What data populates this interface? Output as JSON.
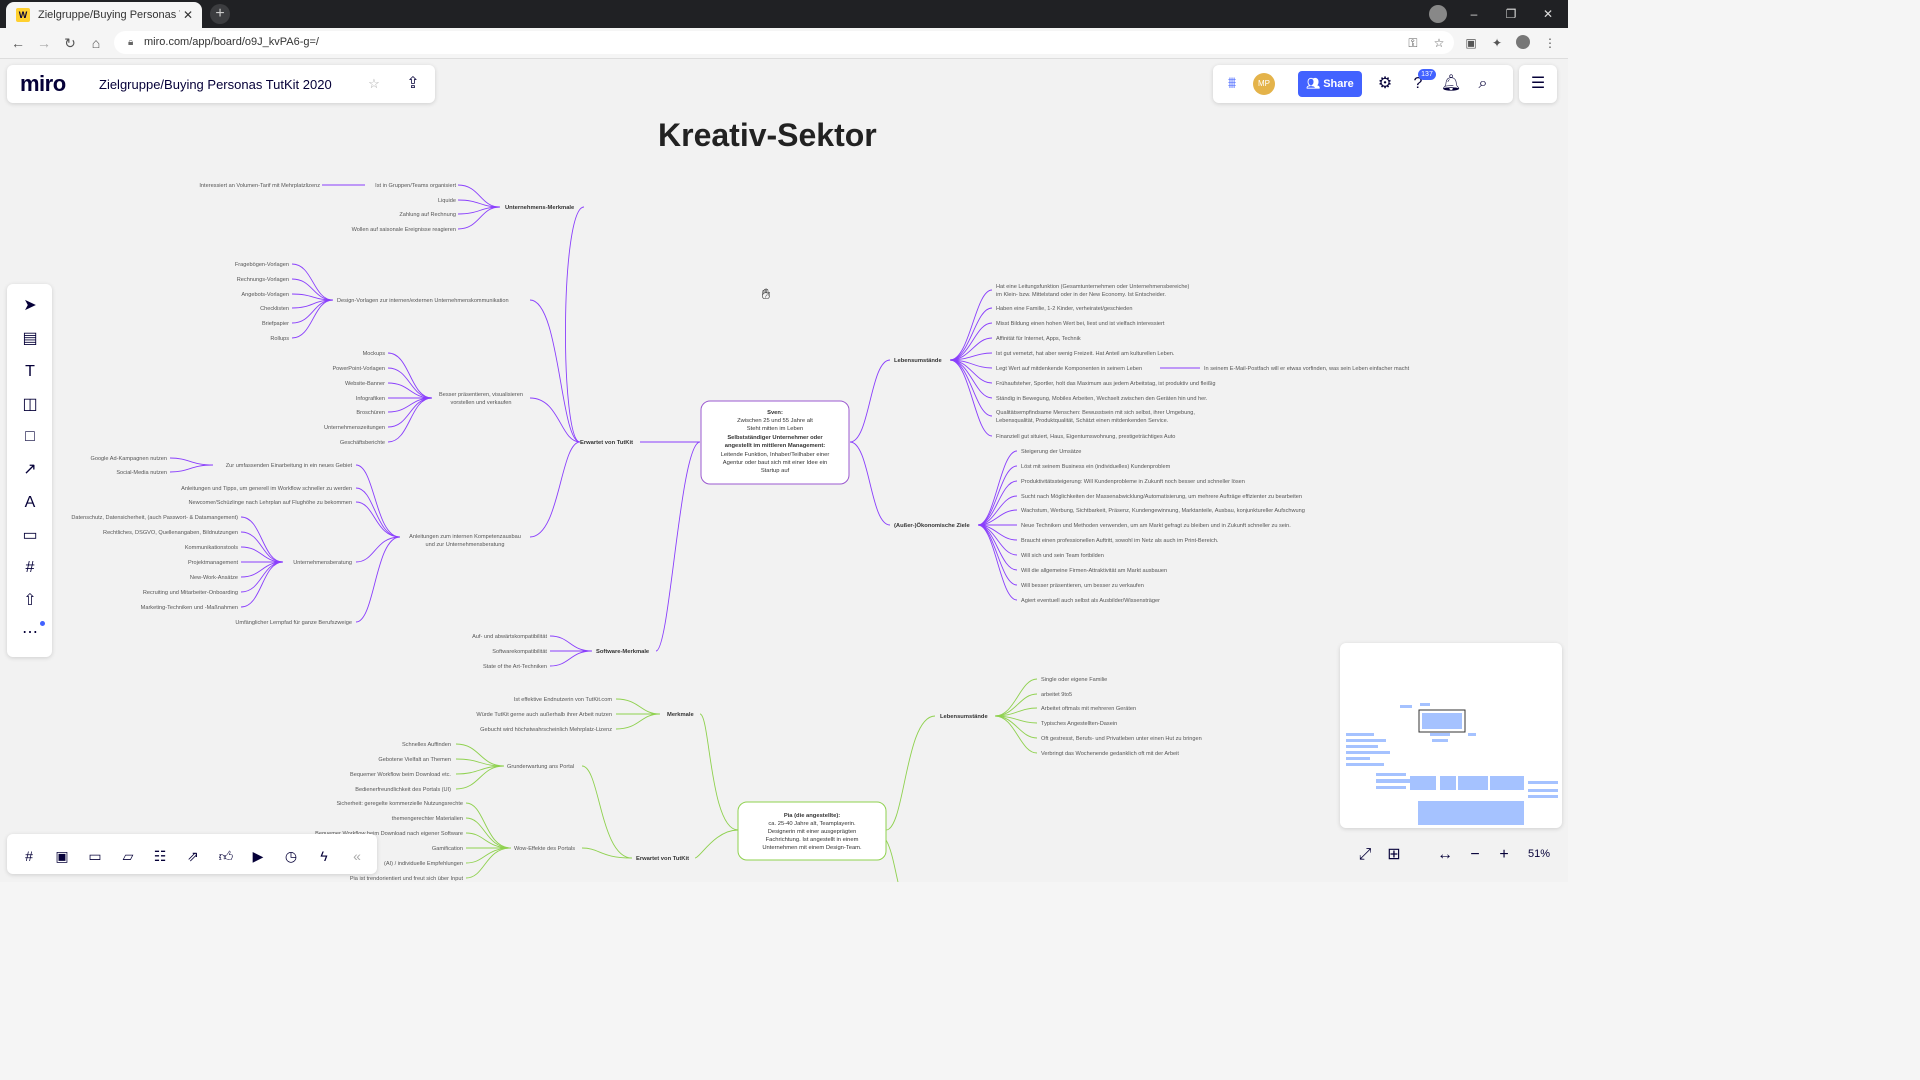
{
  "browser": {
    "tab_title": "Zielgruppe/Buying Personas Tut",
    "tab_favicon": "W",
    "url": "miro.com/app/board/o9J_kvPA6-g=/"
  },
  "app": {
    "logo": "miro",
    "board_name": "Zielgruppe/Buying Personas TutKit 2020",
    "avatar_initials": "MP",
    "share_label": "Share",
    "notification_count": "137",
    "zoom": "51%",
    "accent_color": "#4262ff"
  },
  "frame_title": "Kreativ-Sektor",
  "mindmap_purple": {
    "center": [
      "Sven:",
      "Zwischen 25 und 55 Jahre alt",
      "Steht mitten im Leben",
      "Selbstständiger Unternehmer oder",
      "angestellt im mittleren Management:",
      "Leitende Funktion, Inhaber/Teilhaber einer",
      "Agentur oder baut sich mit einer Idee ein",
      "Startup auf"
    ],
    "expects": "Erwartet von TutKit",
    "company": "Unternehmens-Merkmale",
    "company_items": [
      "Ist in Gruppen/Teams organisiert",
      "Liquide",
      "Zahlung auf Rechnung",
      "Wollen auf saisonale Ereignisse reagieren"
    ],
    "company_sub": "Interessiert an Volumen-Tarif mit Mehrplatzlizenz",
    "design": "Design-Vorlagen zur internen/externen Unternehmenskommunikation",
    "design_items": [
      "Fragebögen-Vorlagen",
      "Rechnungs-Vorlagen",
      "Angebots-Vorlagen",
      "Checklisten",
      "Briefpapier",
      "Rollups"
    ],
    "present": [
      "Besser präsentieren, visualisieren",
      "vorstellen und verkaufen"
    ],
    "present_items": [
      "Mockups",
      "PowerPoint-Vorlagen",
      "Website-Banner",
      "Infografiken",
      "Broschüren",
      "Unternehmenszeitungen",
      "Geschäftsberichte"
    ],
    "guides": [
      "Anleitungen zum internen Kompetenzausbau",
      "und zur Unternehmensberatung"
    ],
    "guides_top": "Zur umfassenden Einarbeitung in ein neues Gebiet",
    "guides_top_items": [
      "Google Ad-Kampagnen nutzen",
      "Social-Media nutzen"
    ],
    "guides_items": [
      "Anleitungen und Tipps, um generell im Workflow schneller zu werden",
      "Newcomer/Schüzlinge nach Lehrplan auf Flughöhe zu bekommen"
    ],
    "consult": "Unternehmensberatung",
    "consult_items": [
      "Datenschutz, Datensicherheit, (auch Passwort- & Datamangement)",
      "Rechtliches, DSGVO, Quellenangaben, Bildnutzungen",
      "Kommunikationstools",
      "Projektmanagement",
      "New-Work-Ansätze",
      "Recruiting und Mitarbeiter-Onboarding",
      "Marketing-Techniken und -Maßnahmen"
    ],
    "guides_last": "Umfänglicher Lernpfad für ganze Berufszweige",
    "software": "Software-Merkmale",
    "software_items": [
      "Auf- und abwärtskompatibilität",
      "Softwarekompatibilität",
      "State of the Art-Techniken"
    ],
    "life": "Lebensumstände",
    "life_items": [
      "Hat eine Leitungsfunktion (Gesamtunternehmen oder Unternehmensbereiche)",
      "im Klein- bzw. Mittelstand oder in der New Economy. Ist Entscheider.",
      "Haben eine Familie, 1-2 Kinder, verheiratet/geschieden",
      "Misst Bildung einen hohen Wert bei, liest und ist vielfach interessiert",
      "Affinität für Internet, Apps, Technik",
      "Ist gut vernetzt, hat aber wenig Freizeit. Hat Anteil am kulturellen Leben.",
      "Legt Wert auf mitdenkende Komponenten in seinem Leben",
      "Frühaufsteher, Sportler, holt das Maximum aus jedem Arbeitstag, ist produktiv und fleißig",
      "Ständig in Bewegung, Mobiles Arbeiten, Wechselt zwischen den Geräten hin und her.",
      "Qualitätsempfindsame Menschen: Bewusstsein mit sich selbst, ihrer Umgebung,",
      "Lebensqualität, Produktqualität, Schätzt einen mitdenkenden Service.",
      "Finanziell gut situiert, Haus, Eigentumswohnung, prestigeträchtiges Auto"
    ],
    "life_sub": "In seinem E-Mail-Postfach will er etwas vorfinden, was sein Leben einfacher macht",
    "goals": "(Außer-)Ökonomische Ziele",
    "goals_items": [
      "Steigerung der Umsätze",
      "Löst mit seinem Business ein (individuelles) Kundenproblem",
      "Produktivitätssteigerung: Will Kundenprobleme in Zukunft noch besser und schneller lösen",
      "Sucht nach Möglichkeiten der Massenabwicklung/Automatisierung, um mehrere Aufträge effizienter zu bearbeiten",
      "Wachstum, Werbung, Sichtbarkeit, Präsenz, Kundengewinnung, Marktanteile, Ausbau, konjunktureller Aufschwung",
      "Neue Techniken und Methoden verwenden, um am Markt gefragt zu bleiben und in Zukunft schneller zu sein.",
      "Braucht einen professionellen Auftritt, sowohl im Netz als auch im Print-Bereich.",
      "Will sich und sein Team fortbilden",
      "Will die allgemeine Firmen-Attraktivität am Markt ausbauen",
      "Will besser präsentieren, um besser zu verkaufen",
      "Agiert eventuell auch selbst als Ausbilder/Wissensträger"
    ]
  },
  "mindmap_green": {
    "center": [
      "Pia (die angestellte):",
      "ca. 25-40 Jahre alt, Teamplayerin.",
      "Designerin mit einer ausgeprägten",
      "Fachrichtung. Ist angestellt in einem",
      "Unternehmen mit einem Design-Team."
    ],
    "traits": "Merkmale",
    "traits_items": [
      "Ist effektive Endnutzerin von TutKit.com",
      "Würde TutKit gerne auch außerhalb ihrer Arbeit nutzen",
      "Gebucht wird höchstwahrscheinlich Mehrplatz-Lizenz"
    ],
    "basic": "Grunderwartung ans Portal",
    "basic_items": [
      "Schnelles Auffinden",
      "Gebotene Vielfalt an Themen",
      "Bequemer Workflow beim Download etc.",
      "Bedienerfreundlichkeit des Portals (UI)"
    ],
    "wow": "Wow-Effekte des Portals",
    "wow_items": [
      "Sicherheit: geregelte kommerzielle Nutzungsrechte",
      "themengerechter Materialien",
      "Bequemer Workflow beim Download nach eigener Software",
      "Gamification",
      "(AI) / individuelle Empfehlungen",
      "Pia ist trendorientiert und freut sich über Input"
    ],
    "expects": "Erwartet von TutKit",
    "life": "Lebensumstände",
    "life_items": [
      "Single oder eigene Familie",
      "arbeitet 9to5",
      "Arbeitet oftmals mit mehreren Geräten",
      "Typisches Angestellten-Dasein",
      "Oft gestresst, Berufs- und Privatleben unter einen Hut zu bringen",
      "Verbringt das Wochenende gedanklich oft mit der Arbeit"
    ]
  },
  "colors": {
    "purple": "#8a3ffc",
    "green": "#8fd14f",
    "center_border": "#9b59d0"
  }
}
